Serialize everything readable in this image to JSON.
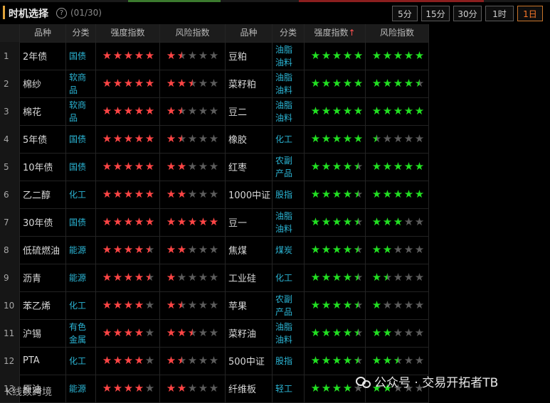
{
  "header": {
    "title": "时机选择",
    "help_icon": "?",
    "count": "(01/30)",
    "timeframes": [
      {
        "label": "5分",
        "active": false
      },
      {
        "label": "15分",
        "active": false
      },
      {
        "label": "30分",
        "active": false
      },
      {
        "label": "1时",
        "active": false
      },
      {
        "label": "1日",
        "active": true
      }
    ]
  },
  "columns": [
    "品种",
    "分类",
    "强度指数",
    "风险指数",
    "品种",
    "分类",
    "强度指数",
    "风险指数"
  ],
  "sort_indicator": "↑",
  "colors": {
    "strength_left": "#ff4545",
    "risk_left": "#ff4545",
    "strength_right": "#22e022",
    "risk_right": "#22e022",
    "empty_star": "#5c5c5c",
    "category": "#2bb6d6"
  },
  "rows": [
    {
      "num": "1",
      "l_name": "2年债",
      "l_cat": "国债",
      "l_str": 5,
      "l_risk": 1.5,
      "r_name": "豆粕",
      "r_cat": "油脂油料",
      "r_str": 5,
      "r_risk": 5
    },
    {
      "num": "2",
      "l_name": "棉纱",
      "l_cat": "软商品",
      "l_str": 5,
      "l_risk": 2.5,
      "r_name": "菜籽粕",
      "r_cat": "油脂油料",
      "r_str": 5,
      "r_risk": 4.5
    },
    {
      "num": "3",
      "l_name": "棉花",
      "l_cat": "软商品",
      "l_str": 5,
      "l_risk": 1.5,
      "r_name": "豆二",
      "r_cat": "油脂油料",
      "r_str": 5,
      "r_risk": 5
    },
    {
      "num": "4",
      "l_name": "5年债",
      "l_cat": "国债",
      "l_str": 5,
      "l_risk": 1.5,
      "r_name": "橡胶",
      "r_cat": "化工",
      "r_str": 5,
      "r_risk": 0.5
    },
    {
      "num": "5",
      "l_name": "10年债",
      "l_cat": "国债",
      "l_str": 5,
      "l_risk": 2,
      "r_name": "红枣",
      "r_cat": "农副产品",
      "r_str": 4.5,
      "r_risk": 5
    },
    {
      "num": "6",
      "l_name": "乙二醇",
      "l_cat": "化工",
      "l_str": 5,
      "l_risk": 2,
      "r_name": "1000中证",
      "r_cat": "股指",
      "r_str": 4.5,
      "r_risk": 5
    },
    {
      "num": "7",
      "l_name": "30年债",
      "l_cat": "国债",
      "l_str": 5,
      "l_risk": 5,
      "r_name": "豆一",
      "r_cat": "油脂油料",
      "r_str": 4.5,
      "r_risk": 3
    },
    {
      "num": "8",
      "l_name": "低硫燃油",
      "l_cat": "能源",
      "l_str": 4.5,
      "l_risk": 2,
      "r_name": "焦煤",
      "r_cat": "煤炭",
      "r_str": 4.5,
      "r_risk": 2
    },
    {
      "num": "9",
      "l_name": "沥青",
      "l_cat": "能源",
      "l_str": 4.5,
      "l_risk": 1,
      "r_name": "工业硅",
      "r_cat": "化工",
      "r_str": 4.5,
      "r_risk": 1.5
    },
    {
      "num": "10",
      "l_name": "苯乙烯",
      "l_cat": "化工",
      "l_str": 4,
      "l_risk": 1.5,
      "r_name": "苹果",
      "r_cat": "农副产品",
      "r_str": 4.5,
      "r_risk": 1
    },
    {
      "num": "11",
      "l_name": "沪锡",
      "l_cat": "有色金属",
      "l_str": 4,
      "l_risk": 2.5,
      "r_name": "菜籽油",
      "r_cat": "油脂油料",
      "r_str": 4.5,
      "r_risk": 2
    },
    {
      "num": "12",
      "l_name": "PTA",
      "l_cat": "化工",
      "l_str": 4,
      "l_risk": 1.5,
      "r_name": "500中证",
      "r_cat": "股指",
      "r_str": 4.5,
      "r_risk": 2.5
    },
    {
      "num": "13",
      "l_name": "原油",
      "l_cat": "能源",
      "l_str": 4,
      "l_risk": 2,
      "r_name": "纤维板",
      "r_cat": "轻工",
      "r_str": 4,
      "r_risk": 2
    }
  ],
  "watermark": {
    "brand": "公众号 · 交易开拓者TB",
    "overlay": "K线数跨境"
  }
}
